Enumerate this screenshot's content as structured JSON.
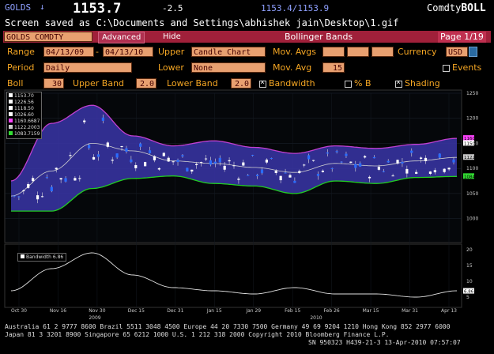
{
  "header": {
    "ticker": "GOLDS",
    "arrow": "↓",
    "price": "1153.7",
    "change": "-2.5",
    "bid_ask": "1153.4/1153.9",
    "brand_prefix": "Comdty",
    "brand": "BOLL"
  },
  "screen_message": "Screen saved as C:\\Documents and Settings\\abhishek jain\\Desktop\\1.gif",
  "toolbar": {
    "security": "GOLDS COMDTY",
    "advanced": "Advanced",
    "hide": "Hide",
    "study": "Bollinger Bands",
    "page": "Page 1/19"
  },
  "settings": {
    "range_label": "Range",
    "range_from": "04/13/09",
    "range_sep": "-",
    "range_to": "04/13/10",
    "upper_label": "Upper",
    "upper_value": "Candle Chart",
    "mov_avgs_label": "Mov. Avgs",
    "currency_label": "Currency",
    "currency_value": "USD",
    "period_label": "Period",
    "period_value": "Daily",
    "lower_label": "Lower",
    "lower_value": "None",
    "mov_avg_label": "Mov. Avg",
    "mov_avg_value": "15",
    "events_label": "Events",
    "boll_label": "Boll",
    "boll_value": "30",
    "upper_band_label": "Upper Band",
    "upper_band_value": "2.0",
    "lower_band_label": "Lower Band",
    "lower_band_value": "2.0",
    "bandwidth_label": "Bandwidth",
    "pct_b_label": "% B",
    "shading_label": "Shading"
  },
  "legend": {
    "items": [
      {
        "label": "1153.70",
        "color": "#ffffff"
      },
      {
        "label": "1226.56",
        "color": "#ffffff"
      },
      {
        "label": "1118.50",
        "color": "#ffffff"
      },
      {
        "label": "1026.60",
        "color": "#ffffff"
      },
      {
        "label": "1160.6687",
        "color": "#ff44ff"
      },
      {
        "label": "1122.2003",
        "color": "#cccccc"
      },
      {
        "label": "1083.7159",
        "color": "#33dd33"
      }
    ]
  },
  "lower_panel_label": "Bandwidth 6.86",
  "axis": {
    "price_ticks": [
      "1250",
      "1200",
      "1150",
      "1100",
      "1050",
      "1000"
    ],
    "price_markers": [
      "1160",
      "1150",
      "1122",
      "1084"
    ],
    "bw_ticks": [
      "20",
      "15",
      "10",
      "5"
    ],
    "bw_marker": "6.86",
    "date_ticks": [
      "Oct 30",
      "Nov 16",
      "Nov 30",
      "Dec 15",
      "Dec 31",
      "Jan 15",
      "Jan 29",
      "Feb 15",
      "Feb 26",
      "Mar 15",
      "Mar 31",
      "Apr 13"
    ],
    "year_ticks": [
      "2009",
      "2010"
    ]
  },
  "footer": {
    "line1": "Australia 61 2 9777 8600 Brazil 5511 3048 4500 Europe 44 20 7330 7500 Germany 49 69 9204 1210 Hong Kong 852 2977 6000",
    "line2": "Japan 81 3 3201 8900         Singapore 65 6212 1000        U.S. 1 212 318 2000              Copyright 2010 Bloomberg Finance L.P.",
    "line3": "SN 950323 H439-21-3 13-Apr-2010 07:57:07"
  },
  "chart_data": {
    "type": "line",
    "title": "",
    "x": [
      "Oct 30",
      "Nov 16",
      "Nov 30",
      "Dec 15",
      "Dec 31",
      "Jan 15",
      "Jan 29",
      "Feb 15",
      "Feb 26",
      "Mar 15",
      "Mar 31",
      "Apr 13"
    ],
    "series": [
      {
        "name": "1160.6687",
        "values": [
          1075,
          1190,
          1226,
          1165,
          1145,
          1155,
          1142,
          1130,
          1145,
          1140,
          1148,
          1160
        ]
      },
      {
        "name": "1122.2003",
        "values": [
          1045,
          1095,
          1150,
          1135,
          1115,
          1110,
          1102,
          1092,
          1110,
          1105,
          1115,
          1122
        ]
      },
      {
        "name": "1083.7159",
        "values": [
          1015,
          1015,
          1060,
          1080,
          1085,
          1070,
          1065,
          1050,
          1075,
          1070,
          1082,
          1084
        ]
      },
      {
        "name": "Bandwidth 6.86",
        "values": [
          7,
          14,
          19,
          12,
          8,
          7,
          6,
          8,
          6,
          6,
          5,
          7
        ]
      }
    ],
    "ylim": [
      960,
      1250
    ],
    "bandwidth_ylim": [
      3,
      21
    ]
  }
}
